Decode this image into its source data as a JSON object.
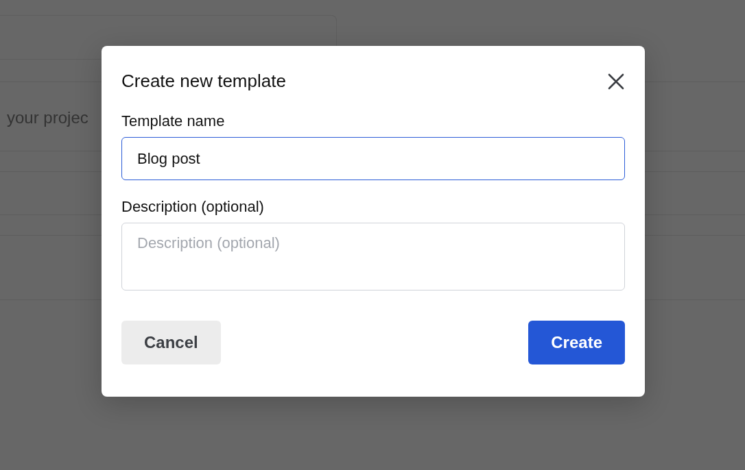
{
  "background": {
    "text": "your projec"
  },
  "dialog": {
    "title": "Create new template",
    "fields": [
      {
        "kind": "input",
        "label": "Template name",
        "value": "Blog post",
        "focused": true
      },
      {
        "kind": "textarea",
        "label": "Description (optional)",
        "placeholder": "Description (optional)",
        "focused": false
      }
    ],
    "buttons": [
      {
        "label": "Cancel",
        "kind": "secondary"
      },
      {
        "label": "Create",
        "kind": "primary"
      }
    ]
  }
}
